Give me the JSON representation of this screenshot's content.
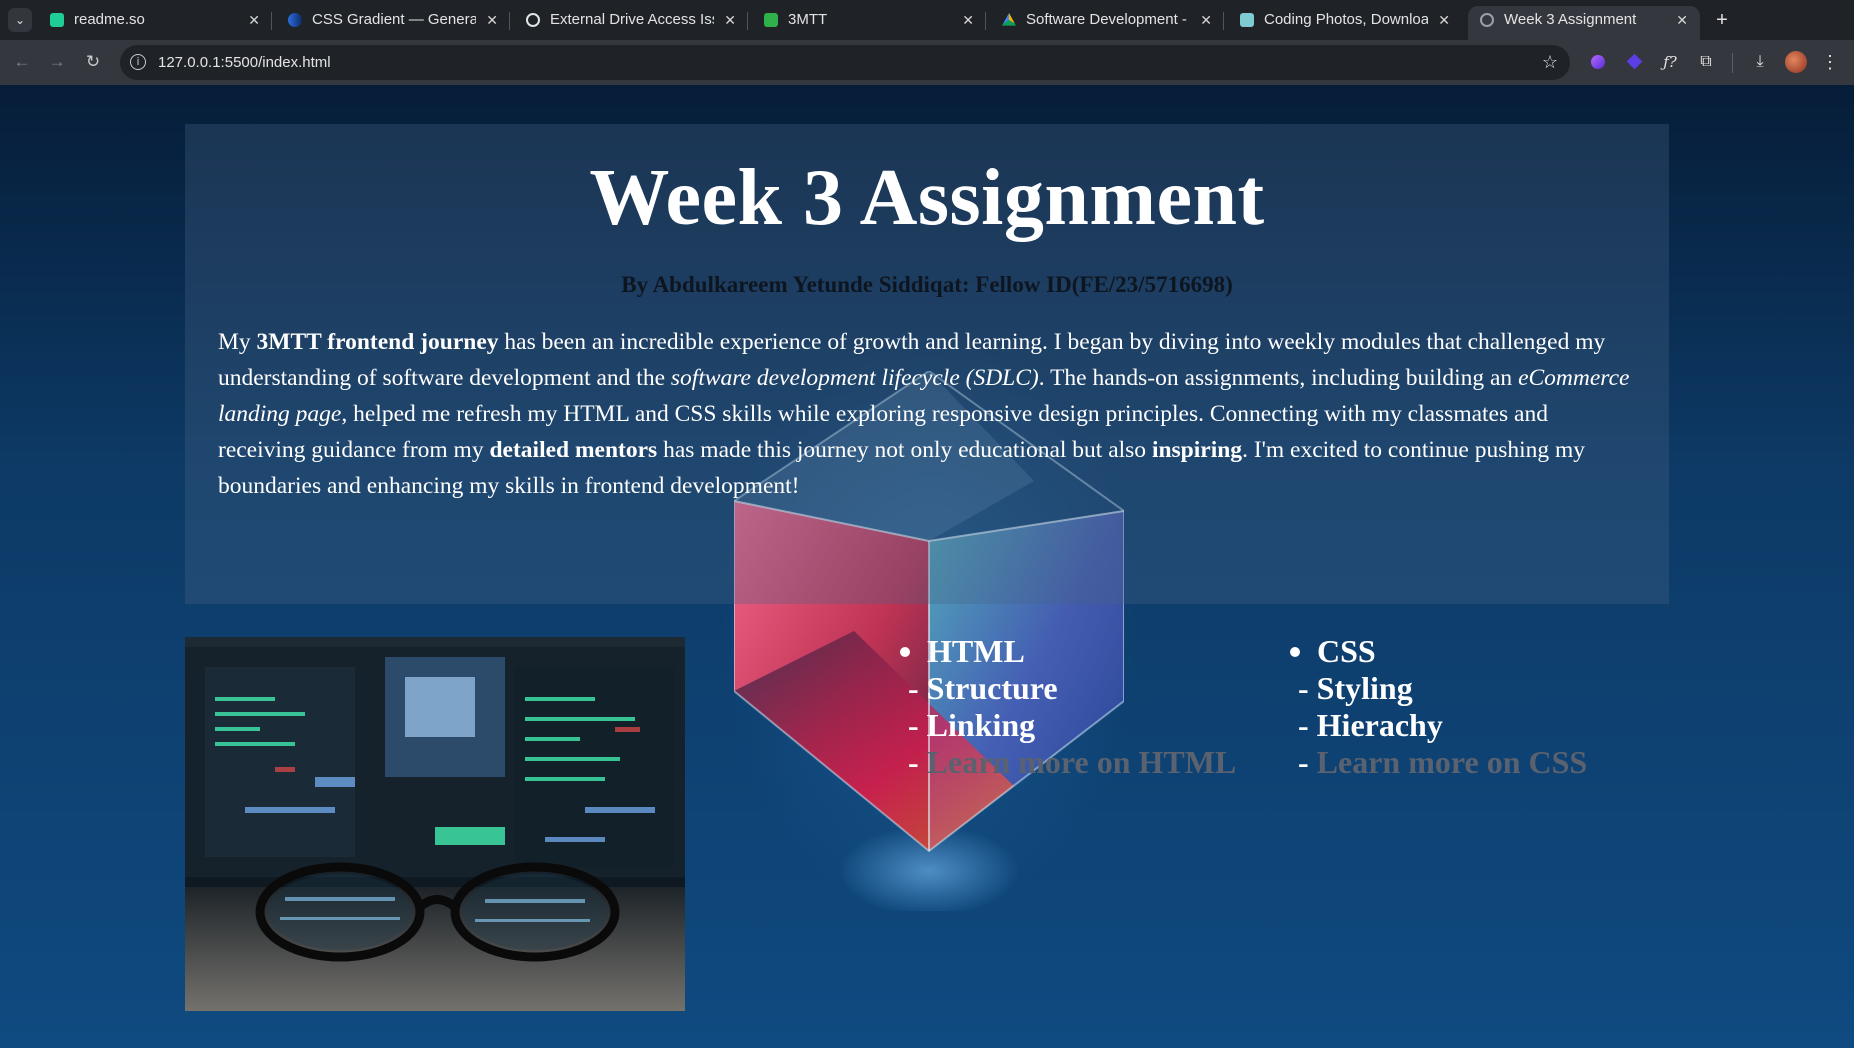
{
  "browser": {
    "tabs": [
      {
        "title": "readme.so",
        "color": "#1fce96"
      },
      {
        "title": "CSS Gradient — Generat",
        "color": "#2a6de0"
      },
      {
        "title": "External Drive Access Iss",
        "color": "#ffffff"
      },
      {
        "title": "3MTT",
        "color": "#2fb24c"
      },
      {
        "title": "Software Development -",
        "color": "#f4b400"
      },
      {
        "title": "Coding Photos, Downloa",
        "color": "#7ecbd2"
      },
      {
        "title": "Week 3 Assignment",
        "color": "#9aa0a6"
      }
    ],
    "active_tab_index": 6,
    "url": "127.0.0.1:5500/index.html"
  },
  "page": {
    "title": "Week 3 Assignment",
    "byline": "By Abdulkareem Yetunde Siddiqat: Fellow ID(FE/23/5716698)",
    "intro": {
      "t1": "My ",
      "b1": "3MTT frontend journey",
      "t2": " has been an incredible experience of growth and learning. I began by diving into weekly modules that challenged my understanding of software development and the ",
      "i1": "software development lifecycle (SDLC)",
      "t3": ". The hands-on assignments, including building an ",
      "i2": "eCommerce landing page",
      "t4": ", helped me refresh my HTML and CSS skills while exploring responsive design principles. Connecting with my classmates and receiving guidance from my ",
      "b2": "detailed mentors",
      "t5": " has made this journey not only educational but also ",
      "b3": "inspiring",
      "t6": ". I'm excited to continue pushing my boundaries and enhancing my skills in frontend development!"
    },
    "html_list": {
      "heading": "HTML",
      "items": [
        "- Structure",
        "- Linking"
      ],
      "link_prefix": "- ",
      "link_text": "Learn more on HTML"
    },
    "css_list": {
      "heading": "CSS",
      "items": [
        "- Styling",
        "- Hierachy"
      ],
      "link_prefix": "- ",
      "link_text": "Learn more on CSS"
    }
  }
}
